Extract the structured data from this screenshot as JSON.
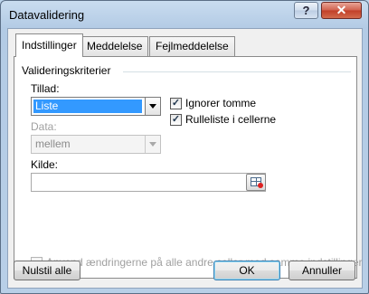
{
  "window": {
    "title": "Datavalidering",
    "help_glyph": "?",
    "close_glyph": "✕"
  },
  "tabs": [
    {
      "label": "Indstillinger",
      "active": true
    },
    {
      "label": "Meddelelse",
      "active": false
    },
    {
      "label": "Fejlmeddelelse",
      "active": false
    }
  ],
  "validation": {
    "group_title": "Valideringskriterier",
    "allow": {
      "label": "Tillad:",
      "value": "Liste"
    },
    "data": {
      "label": "Data:",
      "value": "mellem"
    },
    "ignore_blank": {
      "label": "Ignorer tomme",
      "checked": true
    },
    "in_cell_dropdown": {
      "label": "Rulleliste i cellerne",
      "checked": true
    },
    "source": {
      "label": "Kilde:",
      "value": ""
    }
  },
  "apply_all": {
    "label": "Anvend ændringerne på alle andre celler med samme indstillinger",
    "checked": false
  },
  "buttons": {
    "clear_all": "Nulstil alle",
    "ok": "OK",
    "cancel": "Annuller"
  },
  "checkmark_glyph": "✓"
}
